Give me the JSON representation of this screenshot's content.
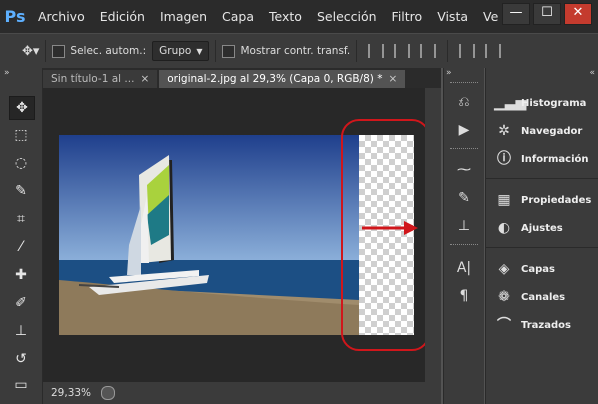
{
  "app": {
    "logo": "Ps",
    "menus": [
      "Archivo",
      "Edición",
      "Imagen",
      "Capa",
      "Texto",
      "Selección",
      "Filtro",
      "Vista",
      "Ve"
    ]
  },
  "window_controls": {
    "minimize": "—",
    "maximize": "☐",
    "close": "✕"
  },
  "options_bar": {
    "auto_select_label": "Selec. autom.:",
    "auto_select_mode": "Grupo",
    "show_transform_label": "Mostrar contr. transf."
  },
  "documents": {
    "tabs": [
      {
        "label": "Sin título-1 al ...",
        "close": "×"
      },
      {
        "label": "original-2.jpg al 29,3% (Capa 0, RGB/8) *",
        "close": "×"
      }
    ]
  },
  "status": {
    "zoom": "29,33%"
  },
  "panels": [
    {
      "label": "Histograma",
      "icon": "histogram-icon"
    },
    {
      "label": "Navegador",
      "icon": "navigator-icon"
    },
    {
      "label": "Información",
      "icon": "info-icon"
    },
    {
      "label": "Propiedades",
      "icon": "properties-icon"
    },
    {
      "label": "Ajustes",
      "icon": "adjustments-icon"
    },
    {
      "label": "Capas",
      "icon": "layers-icon"
    },
    {
      "label": "Canales",
      "icon": "channels-icon"
    },
    {
      "label": "Trazados",
      "icon": "paths-icon"
    }
  ],
  "colors": {
    "annotation": "#d0161b",
    "accent": "#5eb0ff"
  }
}
